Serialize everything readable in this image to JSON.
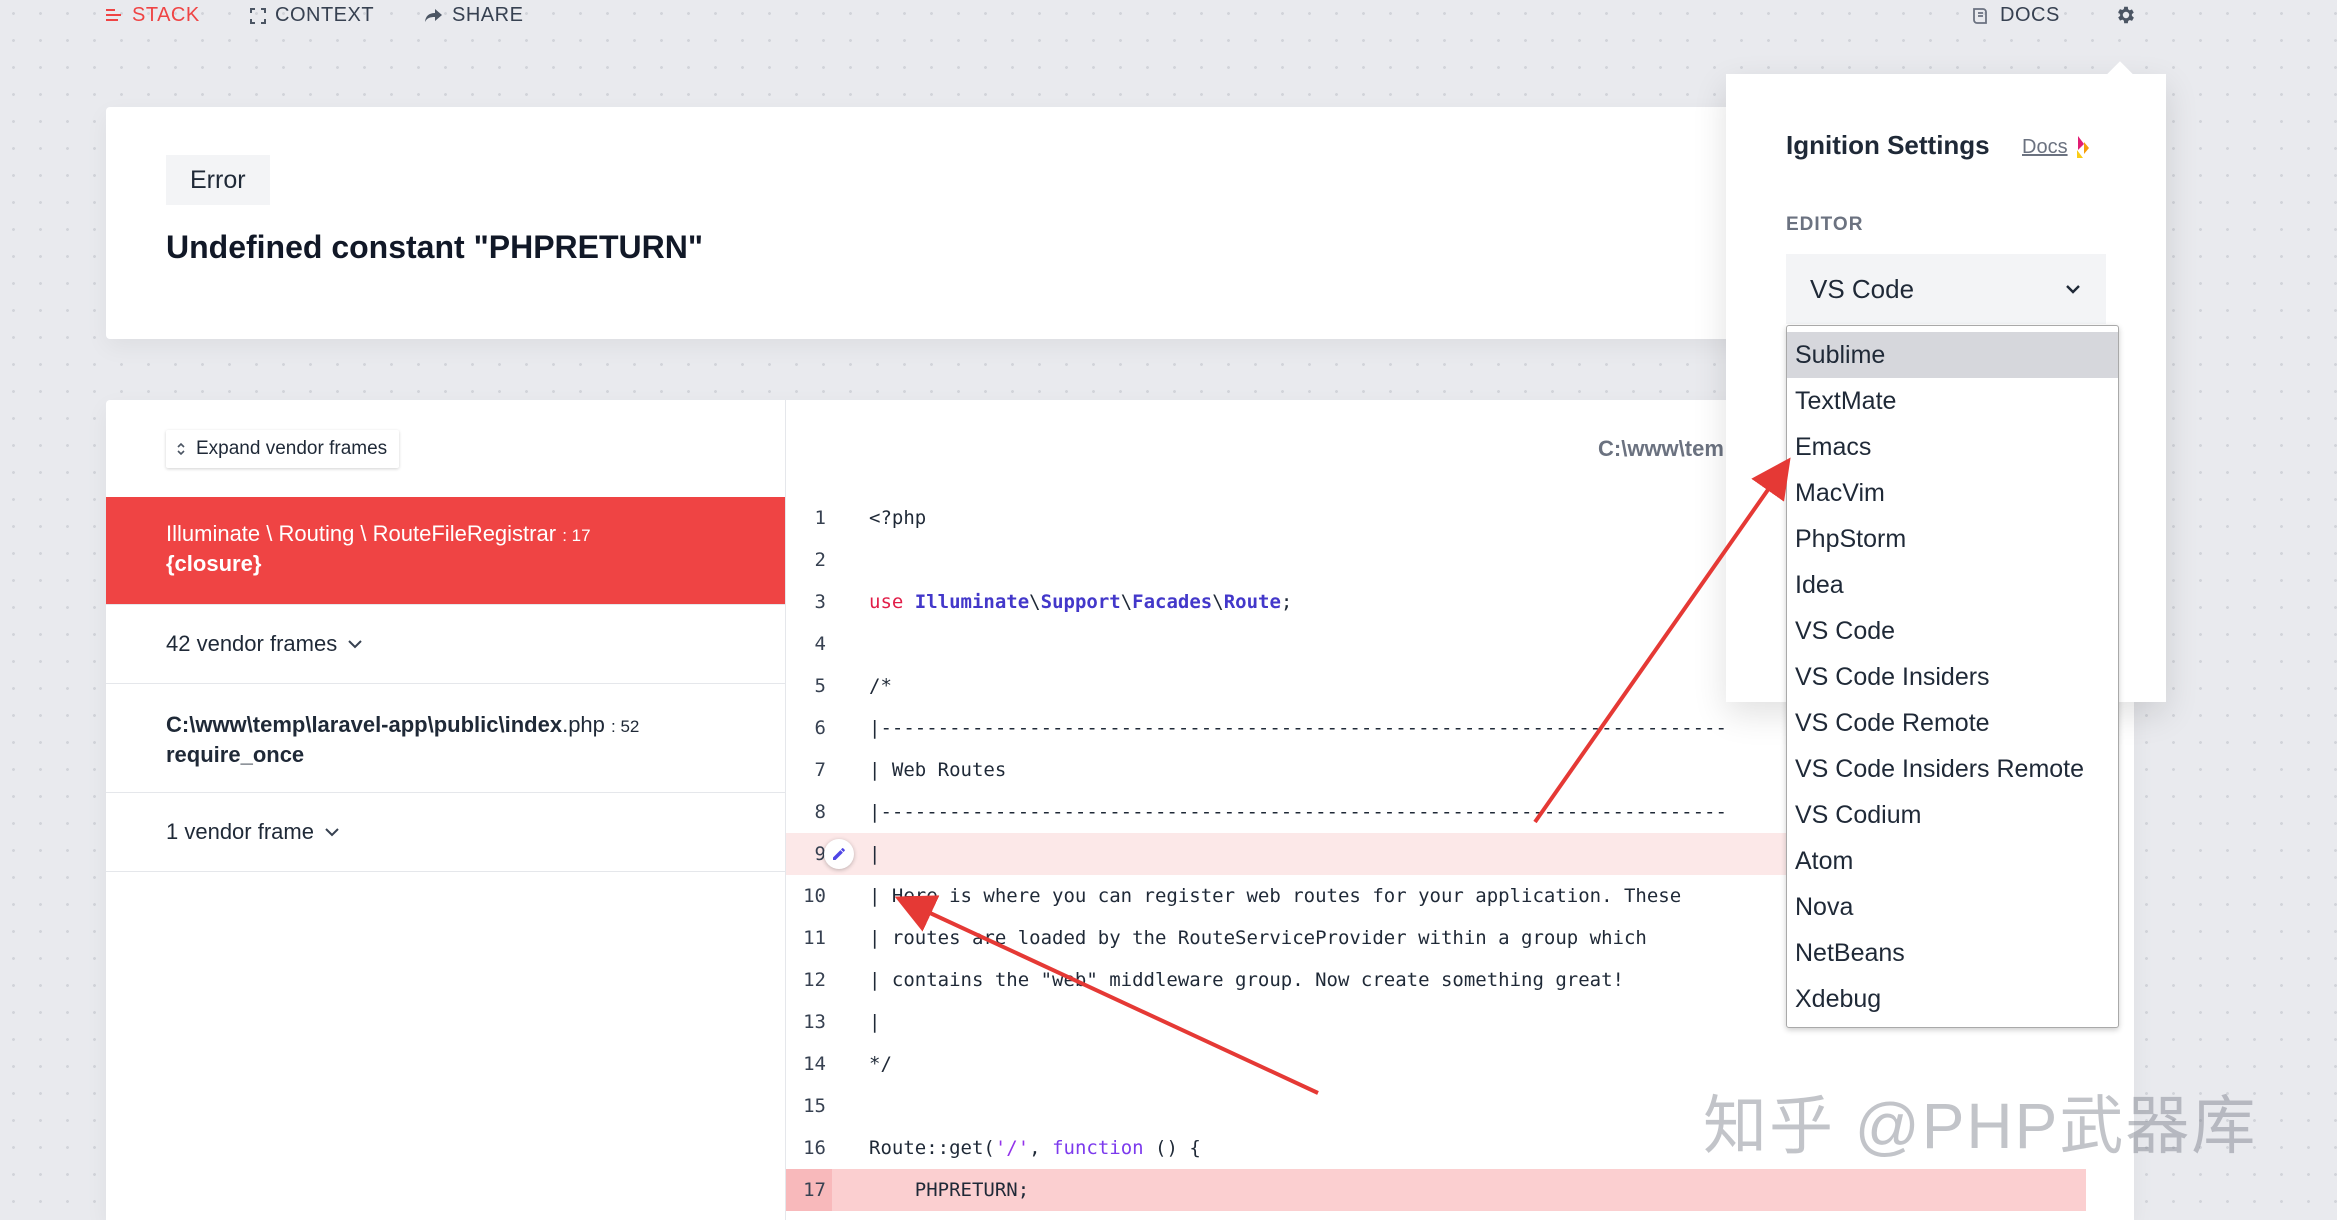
{
  "nav": {
    "stack": "STACK",
    "context": "CONTEXT",
    "share": "SHARE",
    "docs": "DOCS"
  },
  "error": {
    "badge": "Error",
    "message": "Undefined constant \"PHPRETURN\""
  },
  "frames": {
    "expand_label": "Expand vendor frames",
    "active": {
      "class": "Illuminate \\ Routing \\ RouteFileRegistrar",
      "line": ": 17",
      "function": "{closure}"
    },
    "vendor_group_1": "42 vendor frames",
    "file_frame": {
      "path": "C:\\www\\temp\\laravel-app\\public\\index",
      "ext": ".php",
      "line": ": 52",
      "function": "require_once"
    },
    "vendor_group_2": "1 vendor frame"
  },
  "code": {
    "file_path": "C:\\www\\tem",
    "line_numbers": [
      "1",
      "2",
      "3",
      "4",
      "5",
      "6",
      "7",
      "8",
      "9",
      "10",
      "11",
      "12",
      "13",
      "14",
      "15",
      "16",
      "17"
    ],
    "php_tag": "<?php",
    "use_kw": "use",
    "ns_1": "Illuminate",
    "ns_2": "Support",
    "ns_3": "Facades",
    "ns_4": "Route",
    "sep": "\\",
    "semicolon": ";",
    "line_5": "/*",
    "line_6": "|--------------------------------------------------------------------------",
    "line_7": "| Web Routes",
    "line_8": "|--------------------------------------------------------------------------",
    "line_9": "|",
    "line_10": "| Here is where you can register web routes for your application. These",
    "line_11": "| routes are loaded by the RouteServiceProvider within a group which",
    "line_12": "| contains the \"web\" middleware group. Now create something great!",
    "line_13": "|",
    "line_14": "*/",
    "line_16_a": "Route::get(",
    "line_16_str": "'/'",
    "line_16_b": ", ",
    "line_16_fn": "function",
    "line_16_c": " () {",
    "line_17": "    PHPRETURN;"
  },
  "settings": {
    "title": "Ignition Settings",
    "docs_link": "Docs",
    "editor_label": "EDITOR",
    "editor_value": "VS Code",
    "options": [
      "Sublime",
      "TextMate",
      "Emacs",
      "MacVim",
      "PhpStorm",
      "Idea",
      "VS Code",
      "VS Code Insiders",
      "VS Code Remote",
      "VS Code Insiders Remote",
      "VS Codium",
      "Atom",
      "Nova",
      "NetBeans",
      "Xdebug"
    ],
    "selected_option": "Sublime"
  },
  "watermark": "知乎 @PHP武器库",
  "colors": {
    "accent_red": "#ef4444",
    "annotation_arrow": "#e53935",
    "keyword": "#e11d48",
    "class_name": "#4338ca"
  }
}
